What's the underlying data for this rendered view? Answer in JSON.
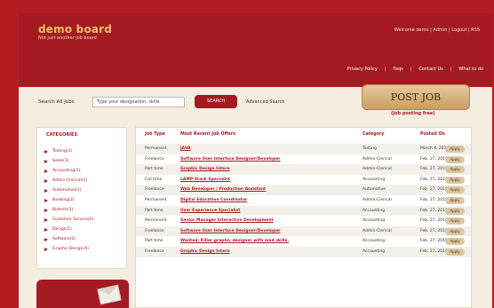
{
  "header": {
    "brand": "demo board",
    "tagline": "Not just another job board",
    "userbar": "Welcome demo | Admin | Logout | RSS",
    "nav": [
      "Privacy Policy",
      "Faqs",
      "Contact Us",
      "What to do"
    ]
  },
  "search": {
    "label": "Search All Jobs",
    "placeholder": "Type your designation, skills",
    "button": "SEARCH",
    "advanced": "Advanced Search"
  },
  "post": {
    "button": "POST JOB",
    "caption": "(Job posting free)"
  },
  "categories": {
    "title": "CATEGORIES",
    "items": [
      "Testing(1)",
      "Sales(1)",
      "Accounting(1)",
      "Admin-Clerical(1)",
      "Automotive(1)",
      "Banking(2)",
      "Biotech(1)",
      "Customer Service(2)",
      "Design(1)",
      "Software(2)",
      "Graphic Design(4)"
    ]
  },
  "table": {
    "headers": [
      "Job Type",
      "Most Recent Job Offers",
      "Category",
      "Posted On"
    ],
    "apply_label": "Apply",
    "rows": [
      {
        "type": "Permanent",
        "title": "JAVA",
        "category": "Testing",
        "date": "March 4, 2010"
      },
      {
        "type": "Freelance",
        "title": "Software User Interface Designer/Developer",
        "category": "Admin-Clerical",
        "date": "Feb. 27, 2010"
      },
      {
        "type": "Part time",
        "title": "Graphic Design Intern",
        "category": "Admin-Clerical",
        "date": "Feb. 27, 2010"
      },
      {
        "type": "Full time",
        "title": "LAMP Stack Specialist",
        "category": "Accounting",
        "date": "Feb. 27, 2010"
      },
      {
        "type": "Freelance",
        "title": "Web Developer / Production Assistant",
        "category": "Automotive",
        "date": "Feb. 27, 2010"
      },
      {
        "type": "Permanent",
        "title": "Digital Education Coordinator",
        "category": "Admin-Clerical",
        "date": "Feb. 27, 2010"
      },
      {
        "type": "Part time",
        "title": "User Experience Specialist",
        "category": "Accounting",
        "date": "Feb. 27, 2010"
      },
      {
        "type": "Permanent",
        "title": "Senior Manager Interactive Development",
        "category": "Accounting",
        "date": "Feb. 27, 2010"
      },
      {
        "type": "Freelance",
        "title": "Software User Interface Designer/Developer",
        "category": "Admin-Clerical",
        "date": "Feb. 27, 2010"
      },
      {
        "type": "Part time",
        "title": "Wanted: Killer graphic designer with mad skills.",
        "category": "Accounting",
        "date": "Feb. 27, 2010"
      },
      {
        "type": "Freelance",
        "title": "Graphic Design Intern",
        "category": "Accounting",
        "date": "Feb. 27, 2010"
      }
    ]
  }
}
